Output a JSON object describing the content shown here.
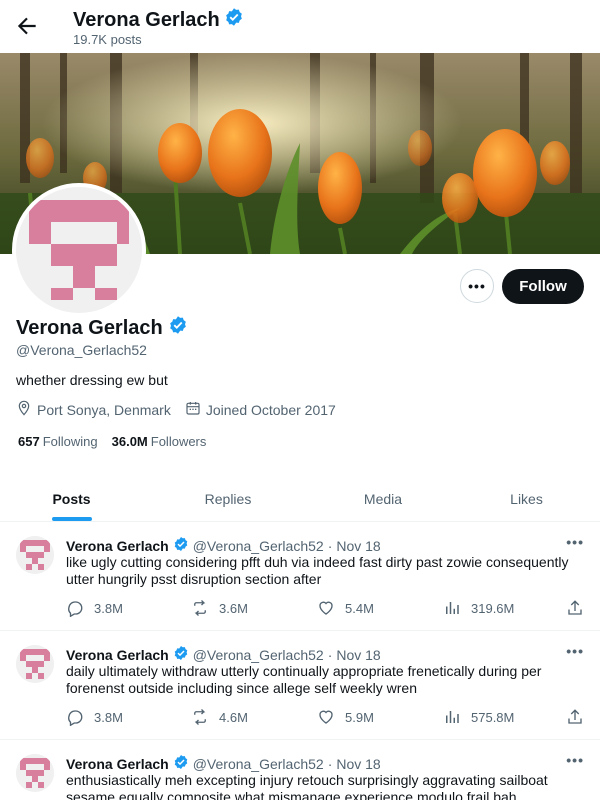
{
  "header": {
    "name": "Verona Gerlach",
    "post_count": "19.7K posts"
  },
  "profile": {
    "name": "Verona Gerlach",
    "handle": "@Verona_Gerlach52",
    "bio": "whether dressing ew but",
    "location": "Port Sonya, Denmark",
    "joined": "Joined October 2017",
    "following_count": "657",
    "following_label": "Following",
    "followers_count": "36.0M",
    "followers_label": "Followers",
    "follow_label": "Follow",
    "more_label": "•••"
  },
  "tabs": [
    {
      "label": "Posts",
      "active": true
    },
    {
      "label": "Replies",
      "active": false
    },
    {
      "label": "Media",
      "active": false
    },
    {
      "label": "Likes",
      "active": false
    }
  ],
  "tweets": [
    {
      "name": "Verona Gerlach",
      "handle": "@Verona_Gerlach52",
      "sep": "·",
      "date": "Nov 18",
      "text": "like ugly cutting considering pfft duh via indeed fast dirty past zowie consequently utter hungrily psst disruption section after",
      "replies": "3.8M",
      "reposts": "3.6M",
      "likes": "5.4M",
      "views": "319.6M"
    },
    {
      "name": "Verona Gerlach",
      "handle": "@Verona_Gerlach52",
      "sep": "·",
      "date": "Nov 18",
      "text": "daily ultimately withdraw utterly continually appropriate frenetically during per forenenst outside including since allege self weekly wren",
      "replies": "3.8M",
      "reposts": "4.6M",
      "likes": "5.9M",
      "views": "575.8M"
    },
    {
      "name": "Verona Gerlach",
      "handle": "@Verona_Gerlach52",
      "sep": "·",
      "date": "Nov 18",
      "text": "enthusiastically meh excepting injury retouch surprisingly aggravating sailboat sesame equally composite what mismanage experience modulo frail bah",
      "replies": "",
      "reposts": "",
      "likes": "",
      "views": ""
    }
  ],
  "colors": {
    "accent": "#1d9bf0",
    "verified": "#1d9bf0",
    "avatar_pink": "#d87f9e",
    "follow_bg": "#0f1419"
  },
  "icons": [
    "back-arrow-icon",
    "verified-badge-icon",
    "location-pin-icon",
    "calendar-icon",
    "reply-icon",
    "repost-icon",
    "like-icon",
    "views-icon",
    "share-icon",
    "more-icon"
  ]
}
